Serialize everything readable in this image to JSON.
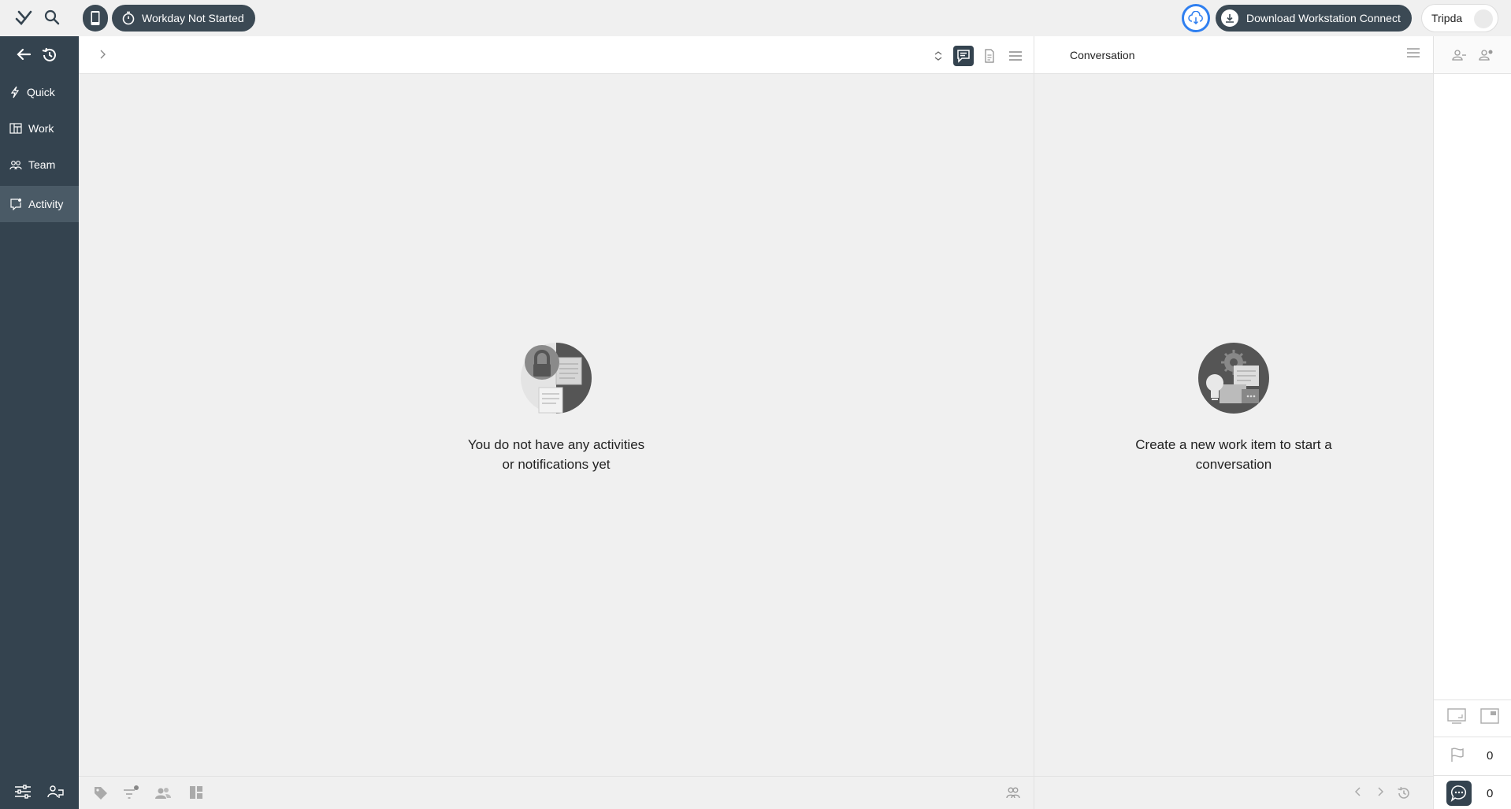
{
  "topbar": {
    "workday_label": "Workday Not Started",
    "download_label": "Download Workstation Connect",
    "user_name": "Tripda"
  },
  "sidebar": {
    "items": [
      {
        "label": "Quick",
        "icon": "lightning-icon"
      },
      {
        "label": "Work",
        "icon": "board-icon"
      },
      {
        "label": "Team",
        "icon": "team-icon"
      },
      {
        "label": "Activity",
        "icon": "activity-icon",
        "active": true
      }
    ]
  },
  "main": {
    "empty_text": "You do not have any activities\nor notifications yet"
  },
  "conversation": {
    "title": "Conversation",
    "empty_text": "Create a new work item to start a\nconversation"
  },
  "rail": {
    "flag_count": "0",
    "chat_count": "0"
  },
  "colors": {
    "sidebar": "#34434f",
    "accent_blue": "#2f7ff0",
    "background": "#f0f0f0"
  }
}
